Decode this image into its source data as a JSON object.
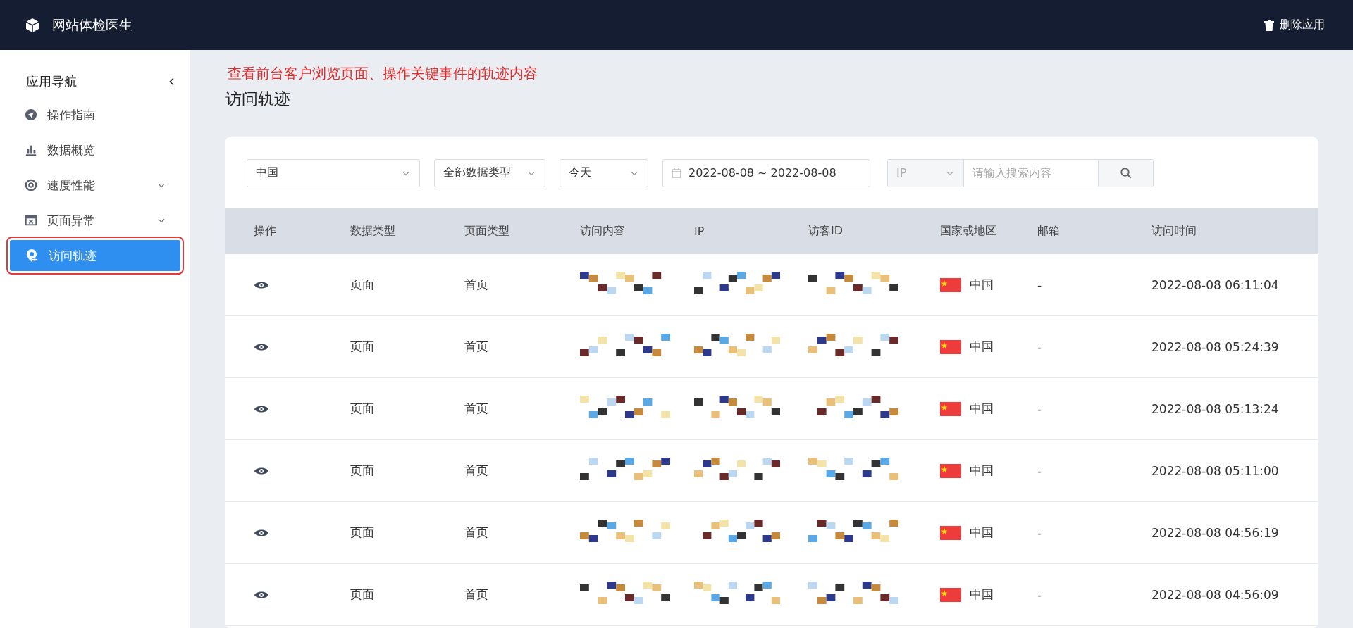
{
  "header": {
    "title": "网站体检医生",
    "action": "删除应用"
  },
  "sidebar": {
    "title": "应用导航",
    "items": [
      {
        "label": "操作指南",
        "expandable": false,
        "selected": false
      },
      {
        "label": "数据概览",
        "expandable": false,
        "selected": false
      },
      {
        "label": "速度性能",
        "expandable": true,
        "selected": false
      },
      {
        "label": "页面异常",
        "expandable": true,
        "selected": false
      },
      {
        "label": "访问轨迹",
        "expandable": false,
        "selected": true
      }
    ]
  },
  "annotation": "查看前台客户浏览页面、操作关键事件的轨迹内容",
  "page_title": "访问轨迹",
  "filters": {
    "region": "中国",
    "data_type": "全部数据类型",
    "period": "今天",
    "date_start": "2022-08-08",
    "date_separator": "~",
    "date_end": "2022-08-08",
    "search_field": "IP",
    "search_placeholder": "请输入搜索内容"
  },
  "table": {
    "columns": [
      "操作",
      "数据类型",
      "页面类型",
      "访问内容",
      "IP",
      "访客ID",
      "国家或地区",
      "邮箱",
      "访问时间"
    ],
    "rows": [
      {
        "data_type": "页面",
        "page_type": "首页",
        "country": "中国",
        "email": "-",
        "time": "2022-08-08 06:11:04"
      },
      {
        "data_type": "页面",
        "page_type": "首页",
        "country": "中国",
        "email": "-",
        "time": "2022-08-08 05:24:39"
      },
      {
        "data_type": "页面",
        "page_type": "首页",
        "country": "中国",
        "email": "-",
        "time": "2022-08-08 05:13:24"
      },
      {
        "data_type": "页面",
        "page_type": "首页",
        "country": "中国",
        "email": "-",
        "time": "2022-08-08 05:11:00"
      },
      {
        "data_type": "页面",
        "page_type": "首页",
        "country": "中国",
        "email": "-",
        "time": "2022-08-08 04:56:19"
      },
      {
        "data_type": "页面",
        "page_type": "首页",
        "country": "中国",
        "email": "-",
        "time": "2022-08-08 04:56:09"
      }
    ]
  }
}
